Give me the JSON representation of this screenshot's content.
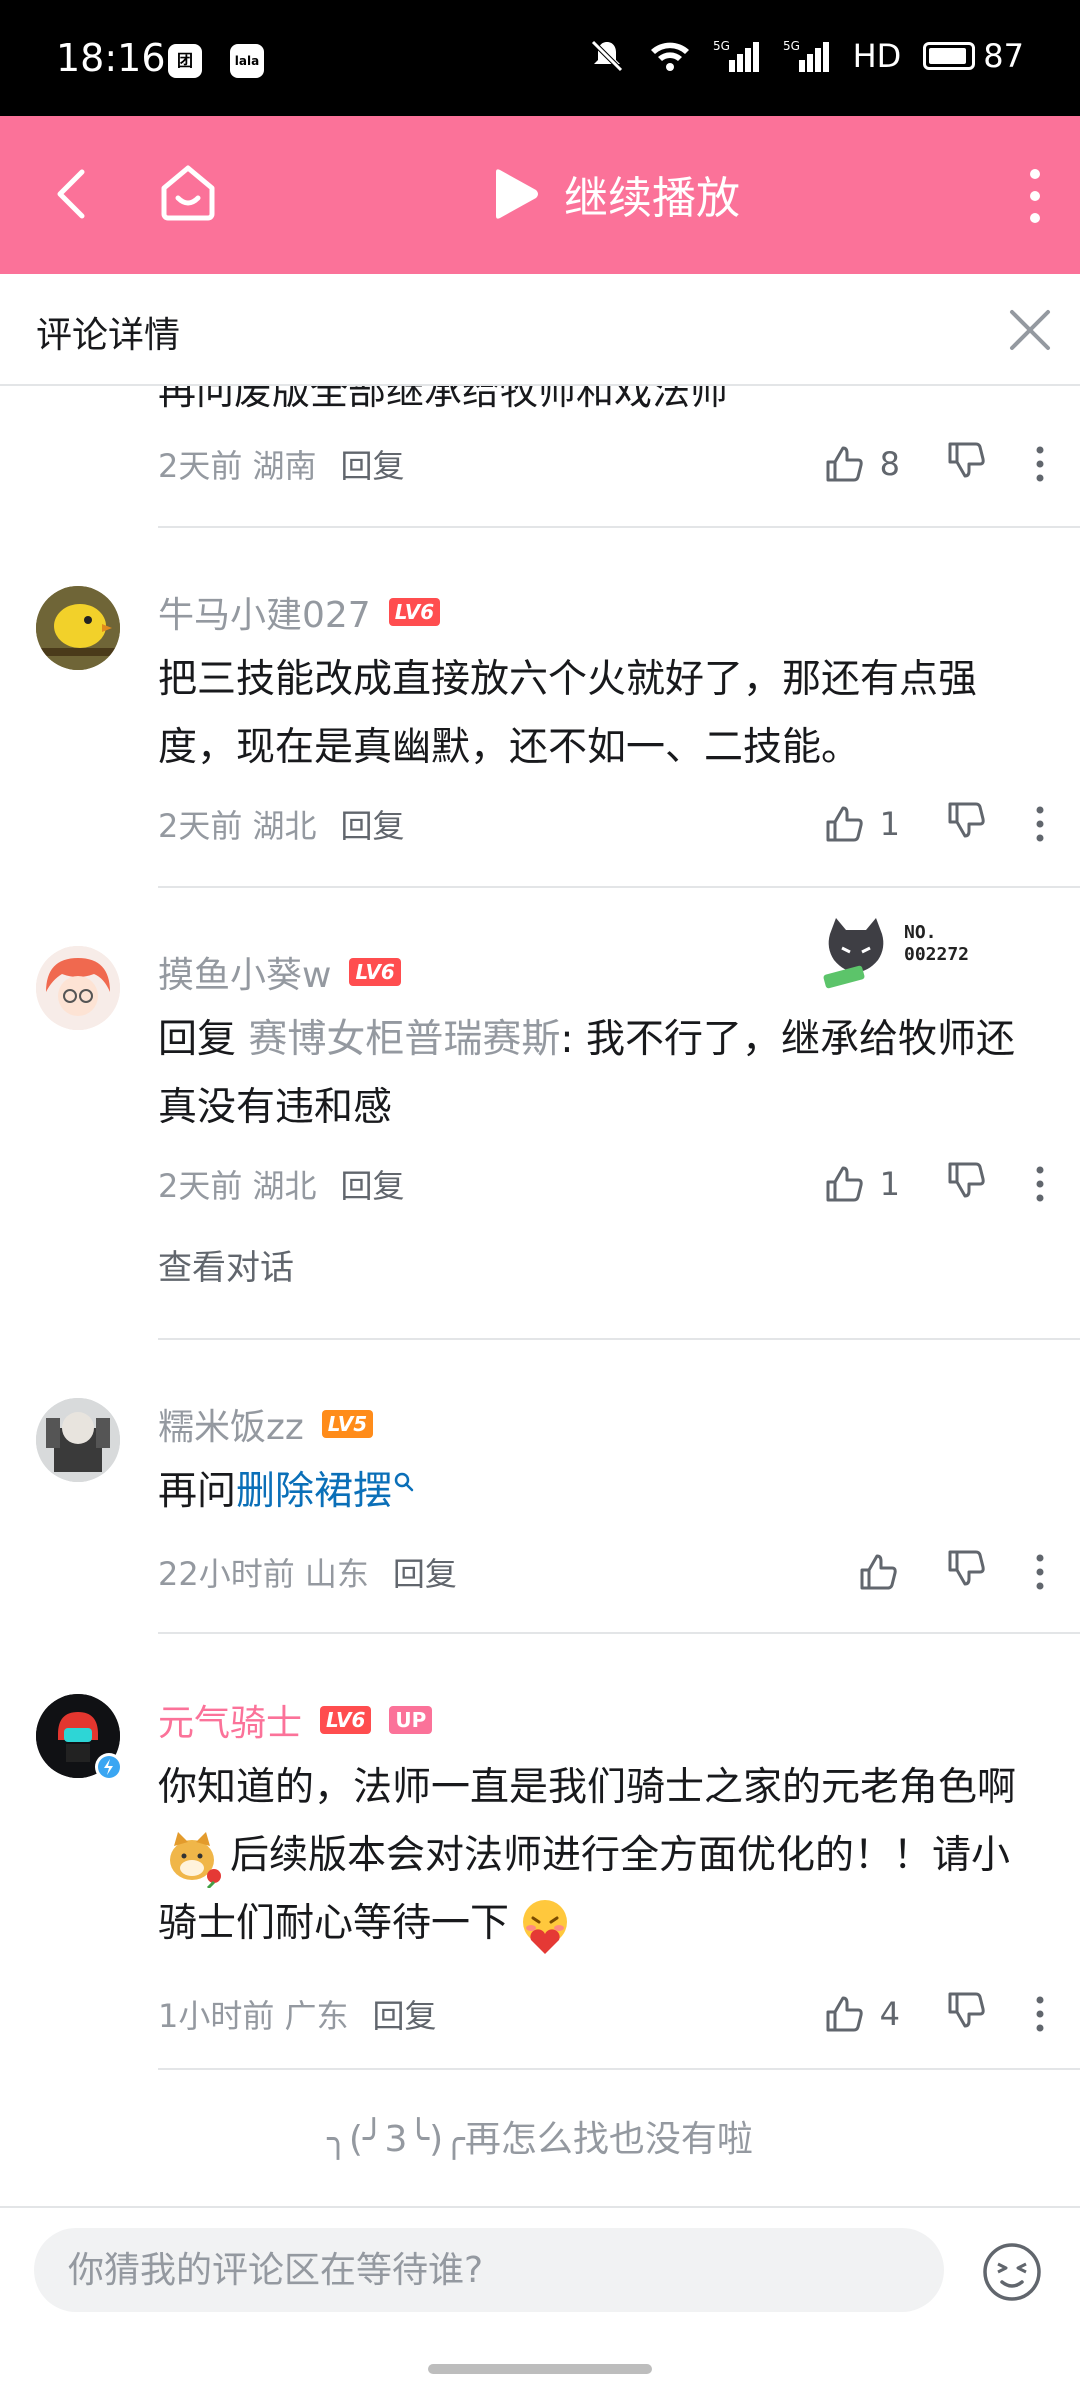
{
  "status_bar": {
    "time": "18:16",
    "left_icons": [
      "团",
      "lala"
    ],
    "network": "HD",
    "battery": "87"
  },
  "top_bar": {
    "continue_label": "继续播放",
    "accent_color": "#fb7299"
  },
  "sheet": {
    "title": "评论详情"
  },
  "partial_comment": {
    "text_cut": "再问废版全部继承给牧师和戏法师",
    "time_loc": "2天前 湖南",
    "reply": "回复",
    "likes": "8"
  },
  "comments": [
    {
      "username": "牛马小建027",
      "level": "LV6",
      "text": "把三技能改成直接放六个火就好了，那还有点强度，现在是真幽默，还不如一、二技能。",
      "time_loc": "2天前 湖北",
      "reply": "回复",
      "likes": "1"
    },
    {
      "username": "摸鱼小葵w",
      "level": "LV6",
      "badge_no": "NO.",
      "badge_code": "002272",
      "reply_prefix": "回复 ",
      "reply_target": "赛博女柜普瑞赛斯",
      "text": ": 我不行了，继承给牧师还真没有违和感",
      "time_loc": "2天前 湖北",
      "reply": "回复",
      "likes": "1",
      "view_conversation": "查看对话"
    },
    {
      "username": "糯米饭zz",
      "level": "LV5",
      "text_prefix": "再问",
      "search_link": "删除裙摆",
      "time_loc": "22小时前 山东",
      "reply": "回复"
    },
    {
      "username": "元气骑士",
      "level": "LV6",
      "up_tag": "UP",
      "text_part1": "你知道的，法师一直是我们骑士之家的元老角色啊",
      "text_part2": "后续版本会对法师进行全方面优化的！！请小骑士们耐心等待一下",
      "time_loc": "1小时前 广东",
      "reply": "回复",
      "likes": "4"
    }
  ],
  "end_note": "╮(╯3╰)╭再怎么找也没有啦",
  "bottom": {
    "placeholder": "你猜我的评论区在等待谁?"
  }
}
